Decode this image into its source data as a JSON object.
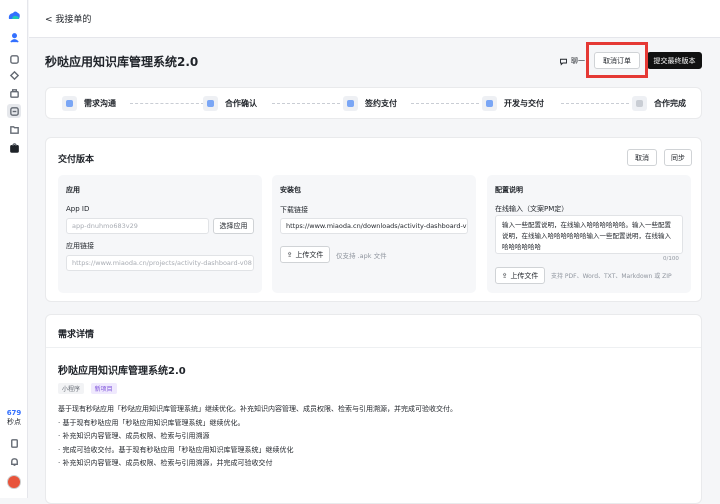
{
  "sidebar": {
    "points_value": "679",
    "points_label": "秒点"
  },
  "topbar": {
    "back_label": "< 我接单的"
  },
  "header": {
    "title": "秒哒应用知识库管理系统2.0",
    "contact_label": "聊一",
    "cancel_order": "取消订单",
    "submit_final": "提交最终版本"
  },
  "steps": [
    {
      "label": "需求沟通"
    },
    {
      "label": "合作确认"
    },
    {
      "label": "签约支付"
    },
    {
      "label": "开发与交付"
    },
    {
      "label": "合作完成"
    }
  ],
  "delivery": {
    "title": "交付版本",
    "cancel": "取消",
    "sync": "同步",
    "app": {
      "title": "应用",
      "app_id_label": "App ID",
      "app_id_placeholder": "app-dnuhmo683v29",
      "select_app": "选择应用",
      "link_label": "应用链接",
      "link_placeholder": "https://www.miaoda.cn/projects/activity-dashboard-v08"
    },
    "package": {
      "title": "安装包",
      "download_label": "下载链接",
      "download_value": "https://www.miaoda.cn/downloads/activity-dashboard-vi",
      "upload": "上传文件",
      "upload_hint": "仅支持 .apk 文件"
    },
    "config": {
      "title": "配置说明",
      "input_label": "在线输入（文案PM定）",
      "text": "输入一些配置说明，在线输入哈哈哈哈哈哈。输入一些配置说明，在线输入哈哈哈哈哈哈输入一些配置说明，在线输入哈哈哈哈哈哈",
      "counter": "0/100",
      "upload": "上传文件",
      "upload_hint": "支持 PDF、Word、TXT、Markdown 或 ZIP"
    }
  },
  "requirements": {
    "title": "需求详情",
    "project_title": "秒哒应用知识库管理系统2.0",
    "tags": [
      "小程序",
      "新项目"
    ],
    "lines": [
      "基于现有秒哒应用「秒哒应用知识库管理系统」继续优化。补充知识内容管理、成员权限、检索与引用溯源，并完成可验收交付。",
      "· 基于现有秒哒应用「秒哒应用知识库管理系统」继续优化。",
      "· 补充知识内容管理、成员权限、检索与引用溯源",
      "· 完成可验收交付。基于现有秒哒应用「秒哒应用知识库管理系统」继续优化",
      "· 补充知识内容管理、成员权限、检索与引用溯源，并完成可验收交付"
    ]
  }
}
